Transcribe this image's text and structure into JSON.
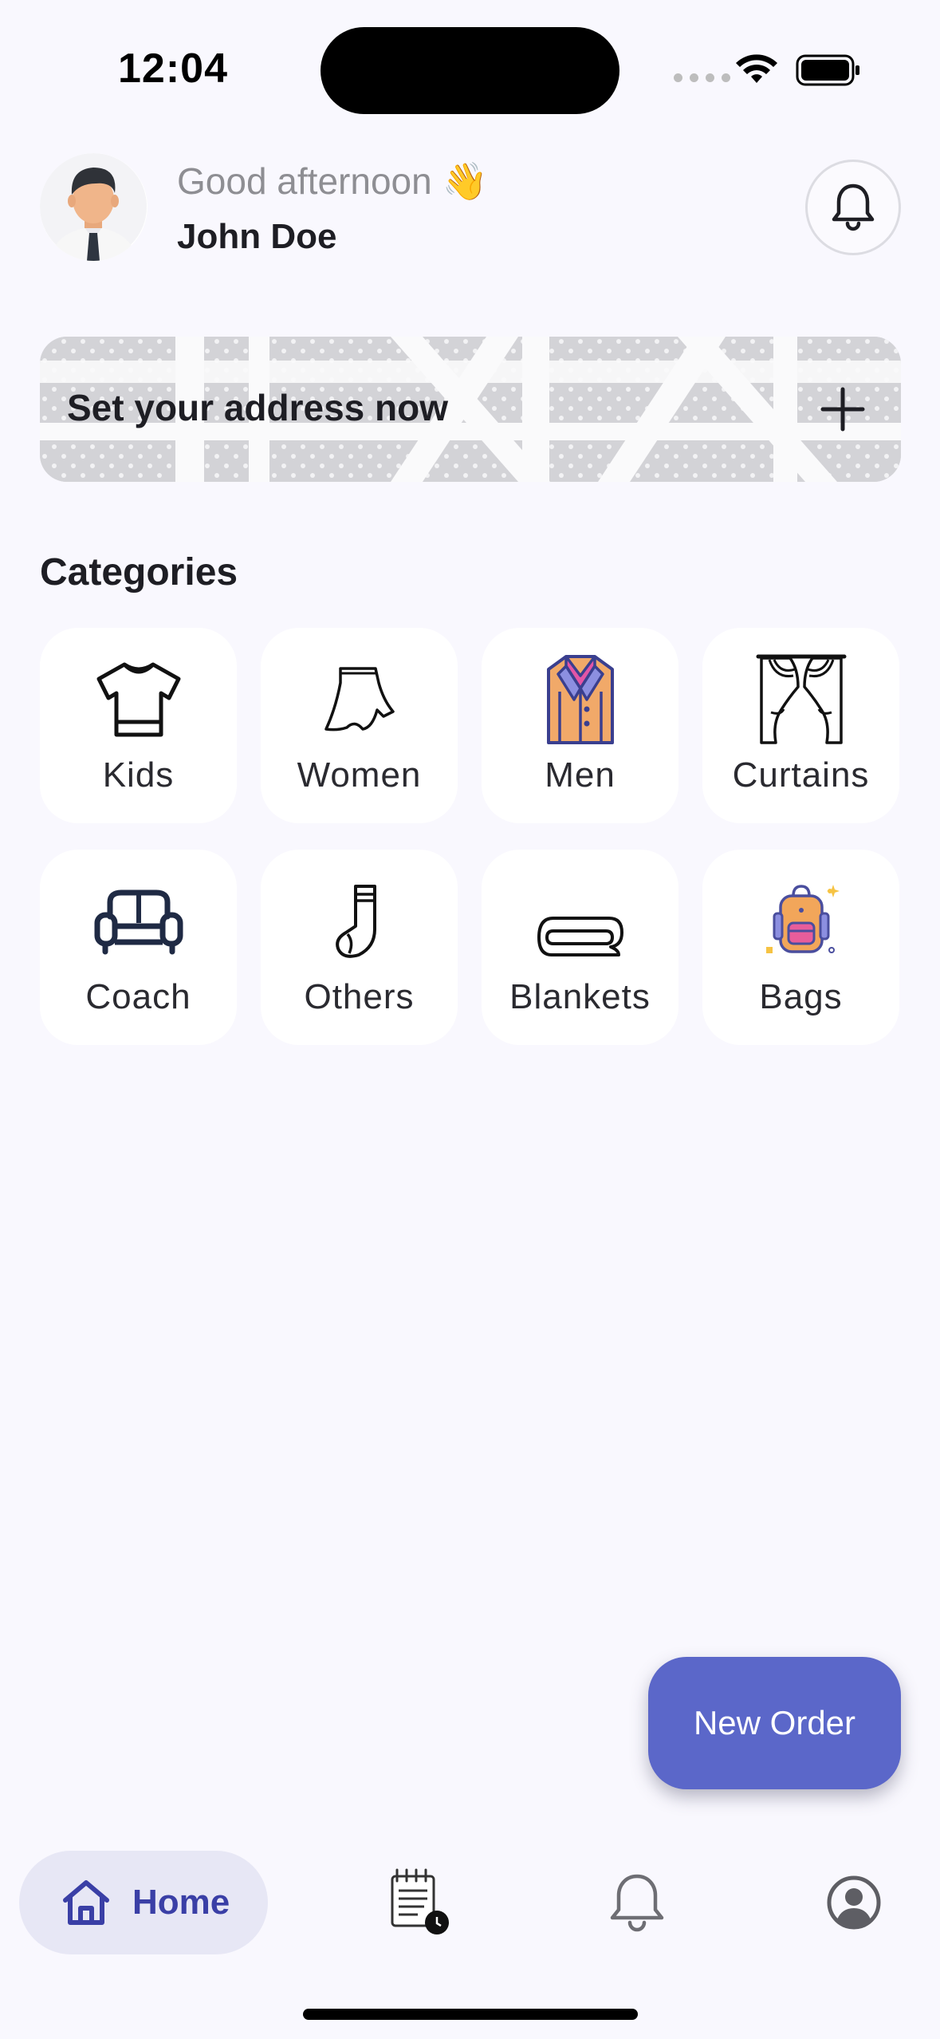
{
  "status_bar": {
    "time": "12:04"
  },
  "header": {
    "greeting": "Good afternoon 👋",
    "name": "John Doe"
  },
  "address_banner": {
    "label": "Set your address now"
  },
  "categories": {
    "title": "Categories",
    "items": [
      {
        "label": "Kids",
        "icon": "tshirt-icon"
      },
      {
        "label": "Women",
        "icon": "skirt-icon"
      },
      {
        "label": "Men",
        "icon": "jacket-icon"
      },
      {
        "label": "Curtains",
        "icon": "curtains-icon"
      },
      {
        "label": "Coach",
        "icon": "sofa-icon"
      },
      {
        "label": "Others",
        "icon": "sock-icon"
      },
      {
        "label": "Blankets",
        "icon": "blanket-icon"
      },
      {
        "label": "Bags",
        "icon": "backpack-icon"
      }
    ]
  },
  "fab": {
    "label": "New Order"
  },
  "bottom_nav": {
    "items": [
      {
        "label": "Home",
        "icon": "home-icon",
        "active": true
      },
      {
        "label": "",
        "icon": "orders-icon",
        "active": false
      },
      {
        "label": "",
        "icon": "bell-icon",
        "active": false
      },
      {
        "label": "",
        "icon": "profile-icon",
        "active": false
      }
    ]
  },
  "colors": {
    "background": "#F9F8FE",
    "accent": "#5B67C9",
    "nav_active_bg": "#E7E7F5",
    "nav_active_text": "#3A3FA6",
    "tile_bg": "#FFFFFF"
  }
}
